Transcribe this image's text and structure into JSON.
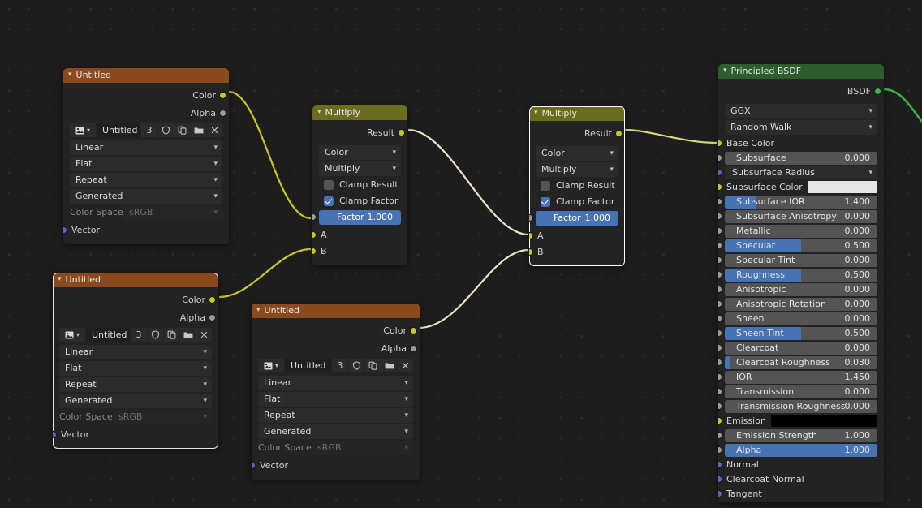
{
  "editor": {
    "background": "#1d1d1d",
    "grid_color": "#2b2b2b"
  },
  "nodes": {
    "image_tex_1": {
      "title": "Untitled",
      "header_color": "#8a4a1e",
      "outputs": [
        {
          "label": "Color",
          "socket": "yellow"
        },
        {
          "label": "Alpha",
          "socket": "gray"
        }
      ],
      "image_name": "Untitled",
      "users": "3",
      "interpolation": "Linear",
      "projection": "Flat",
      "extension": "Repeat",
      "source": "Generated",
      "colorspace_label": "Color Space",
      "colorspace_value": "sRGB",
      "input_label": "Vector",
      "input_socket": "purple"
    },
    "image_tex_2": {
      "title": "Untitled",
      "header_color": "#8a4a1e",
      "outputs": [
        {
          "label": "Color",
          "socket": "yellow"
        },
        {
          "label": "Alpha",
          "socket": "gray"
        }
      ],
      "image_name": "Untitled",
      "users": "3",
      "interpolation": "Linear",
      "projection": "Flat",
      "extension": "Repeat",
      "source": "Generated",
      "colorspace_label": "Color Space",
      "colorspace_value": "sRGB",
      "input_label": "Vector",
      "input_socket": "purple"
    },
    "image_tex_3": {
      "title": "Untitled",
      "header_color": "#8a4a1e",
      "outputs": [
        {
          "label": "Color",
          "socket": "yellow"
        },
        {
          "label": "Alpha",
          "socket": "gray"
        }
      ],
      "image_name": "Untitled",
      "users": "3",
      "interpolation": "Linear",
      "projection": "Flat",
      "extension": "Repeat",
      "source": "Generated",
      "colorspace_label": "Color Space",
      "colorspace_value": "sRGB",
      "input_label": "Vector",
      "input_socket": "purple"
    },
    "mix_1": {
      "title": "Multiply",
      "header_color": "#6c6c1f",
      "output_label": "Result",
      "data_type": "Color",
      "blend_mode": "Multiply",
      "clamp_result_label": "Clamp Result",
      "clamp_result_checked": false,
      "clamp_factor_label": "Clamp Factor",
      "clamp_factor_checked": true,
      "factor_label": "Factor",
      "factor_value": "1.000",
      "input_a": "A",
      "input_b": "B"
    },
    "mix_2": {
      "title": "Multiply",
      "header_color": "#6c6c1f",
      "output_label": "Result",
      "data_type": "Color",
      "blend_mode": "Multiply",
      "clamp_result_label": "Clamp Result",
      "clamp_result_checked": false,
      "clamp_factor_label": "Clamp Factor",
      "clamp_factor_checked": true,
      "factor_label": "Factor",
      "factor_value": "1.000",
      "input_a": "A",
      "input_b": "B"
    },
    "principled": {
      "title": "Principled BSDF",
      "header_color": "#2d5c2d",
      "output_label": "BSDF",
      "distribution": "GGX",
      "subsurface_method": "Random Walk",
      "props": [
        {
          "name": "Base Color",
          "kind": "label",
          "socket": "yellow"
        },
        {
          "name": "Subsurface",
          "kind": "slider",
          "value": "0.000",
          "fill": 0,
          "socket": "gray"
        },
        {
          "name": "Subsurface Radius",
          "kind": "dropdown",
          "value": "",
          "socket": "purple"
        },
        {
          "name": "Subsurface Color",
          "kind": "color",
          "color": "#e4e4e4",
          "socket": "yellow"
        },
        {
          "name": "Subsurface IOR",
          "kind": "slider",
          "value": "1.400",
          "fill": 20,
          "socket": "gray"
        },
        {
          "name": "Subsurface Anisotropy",
          "kind": "slider",
          "value": "0.000",
          "fill": 0,
          "socket": "gray"
        },
        {
          "name": "Metallic",
          "kind": "slider",
          "value": "0.000",
          "fill": 0,
          "socket": "gray"
        },
        {
          "name": "Specular",
          "kind": "slider",
          "value": "0.500",
          "fill": 50,
          "socket": "gray"
        },
        {
          "name": "Specular Tint",
          "kind": "slider",
          "value": "0.000",
          "fill": 0,
          "socket": "gray"
        },
        {
          "name": "Roughness",
          "kind": "slider",
          "value": "0.500",
          "fill": 50,
          "socket": "gray"
        },
        {
          "name": "Anisotropic",
          "kind": "slider",
          "value": "0.000",
          "fill": 0,
          "socket": "gray"
        },
        {
          "name": "Anisotropic Rotation",
          "kind": "slider",
          "value": "0.000",
          "fill": 0,
          "socket": "gray"
        },
        {
          "name": "Sheen",
          "kind": "slider",
          "value": "0.000",
          "fill": 0,
          "socket": "gray"
        },
        {
          "name": "Sheen Tint",
          "kind": "slider",
          "value": "0.500",
          "fill": 50,
          "socket": "gray"
        },
        {
          "name": "Clearcoat",
          "kind": "slider",
          "value": "0.000",
          "fill": 0,
          "socket": "gray"
        },
        {
          "name": "Clearcoat Roughness",
          "kind": "slider",
          "value": "0.030",
          "fill": 3,
          "socket": "gray"
        },
        {
          "name": "IOR",
          "kind": "slider",
          "value": "1.450",
          "fill": 0,
          "socket": "gray"
        },
        {
          "name": "Transmission",
          "kind": "slider",
          "value": "0.000",
          "fill": 0,
          "socket": "gray"
        },
        {
          "name": "Transmission Roughness",
          "kind": "slider",
          "value": "0.000",
          "fill": 0,
          "socket": "gray"
        },
        {
          "name": "Emission",
          "kind": "color",
          "color": "#000000",
          "socket": "yellow"
        },
        {
          "name": "Emission Strength",
          "kind": "slider",
          "value": "1.000",
          "fill": 0,
          "socket": "gray"
        },
        {
          "name": "Alpha",
          "kind": "slider",
          "value": "1.000",
          "fill": 100,
          "socket": "gray"
        },
        {
          "name": "Normal",
          "kind": "label",
          "socket": "purple"
        },
        {
          "name": "Clearcoat Normal",
          "kind": "label",
          "socket": "purple"
        },
        {
          "name": "Tangent",
          "kind": "label",
          "socket": "purple"
        }
      ]
    }
  },
  "links": [
    {
      "from": "image_tex_1.Color",
      "to": "mix_1.A",
      "color": "#c7c729"
    },
    {
      "from": "image_tex_2.Color",
      "to": "mix_1.B",
      "color": "#c7c729"
    },
    {
      "from": "mix_1.Result",
      "to": "mix_2.A",
      "color": "#e4e4c0"
    },
    {
      "from": "image_tex_3.Color",
      "to": "mix_2.B",
      "color": "#e4e4c0"
    },
    {
      "from": "mix_2.Result",
      "to": "principled.Base Color",
      "color": "#d6d67a"
    },
    {
      "from": "principled.BSDF",
      "to": "output",
      "color": "#3cb54a"
    }
  ]
}
